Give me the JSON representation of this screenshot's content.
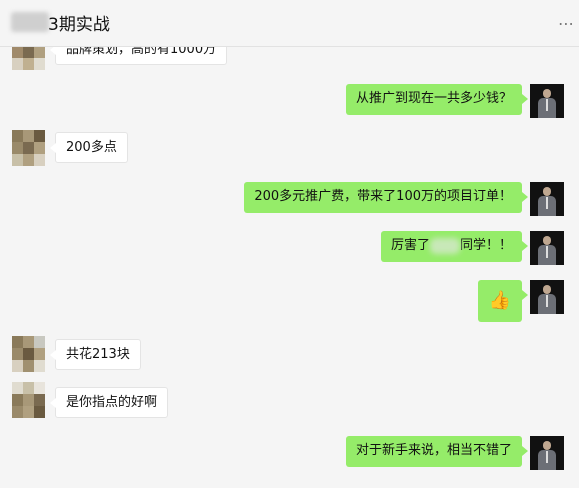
{
  "header": {
    "title": "3期实战",
    "more_icon": "⋯"
  },
  "messages": [
    {
      "side": "in",
      "text": "品牌策划，高的有1000万"
    },
    {
      "side": "out",
      "text": "从推广到现在一共多少钱？"
    },
    {
      "side": "in",
      "text": "200多点"
    },
    {
      "side": "out",
      "text": "200多元推广费，带来了100万的项目订单！"
    },
    {
      "side": "out",
      "text_before": "厉害了",
      "text_after": "同学！！"
    },
    {
      "side": "out",
      "emoji": "👍",
      "icon": "thumbs-up-emoji"
    },
    {
      "side": "in",
      "text": "共花213块"
    },
    {
      "side": "in",
      "text": "是你指点的好啊"
    },
    {
      "side": "out",
      "text": "对于新手来说，相当不错了"
    }
  ],
  "colors": {
    "outgoing_bubble": "#95ec69",
    "incoming_bubble": "#ffffff",
    "background": "#f5f5f5"
  }
}
